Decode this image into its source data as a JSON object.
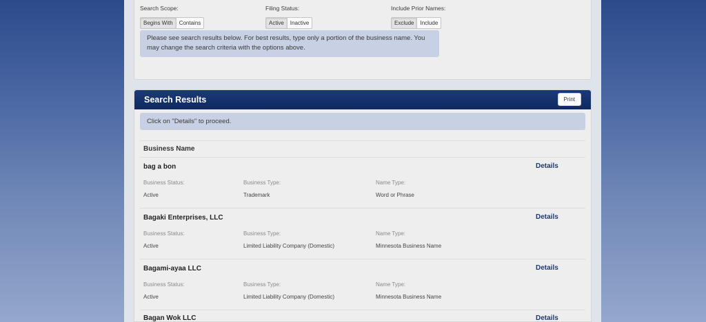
{
  "criteria": {
    "search_scope": {
      "label": "Search Scope:",
      "options": [
        "Begins With",
        "Contains"
      ],
      "selected": "Begins With"
    },
    "filing_status": {
      "label": "Filing Status:",
      "options": [
        "Active",
        "Inactive"
      ],
      "selected": "Active"
    },
    "prior_names": {
      "label": "Include Prior Names:",
      "options": [
        "Exclude",
        "Include"
      ],
      "selected": "Exclude"
    },
    "info": "Please see search results below. For best results, type only a portion of the business name. You may change the search criteria with the options above."
  },
  "results": {
    "title": "Search Results",
    "print_label": "Print",
    "proceed_text": "Click on \"Details\" to proceed.",
    "column_header": "Business Name",
    "details_label": "Details",
    "labels": {
      "status": "Business Status:",
      "type": "Business Type:",
      "name_type": "Name Type:"
    },
    "rows": [
      {
        "name": "bag a bon",
        "status": "Active",
        "type": "Trademark",
        "name_type": "Word or Phrase"
      },
      {
        "name": "Bagaki Enterprises, LLC",
        "status": "Active",
        "type": "Limited Liability Company (Domestic)",
        "name_type": "Minnesota Business Name"
      },
      {
        "name": "Bagami-ayaa LLC",
        "status": "Active",
        "type": "Limited Liability Company (Domestic)",
        "name_type": "Minnesota Business Name"
      },
      {
        "name": "Bagan Wok LLC"
      }
    ]
  }
}
